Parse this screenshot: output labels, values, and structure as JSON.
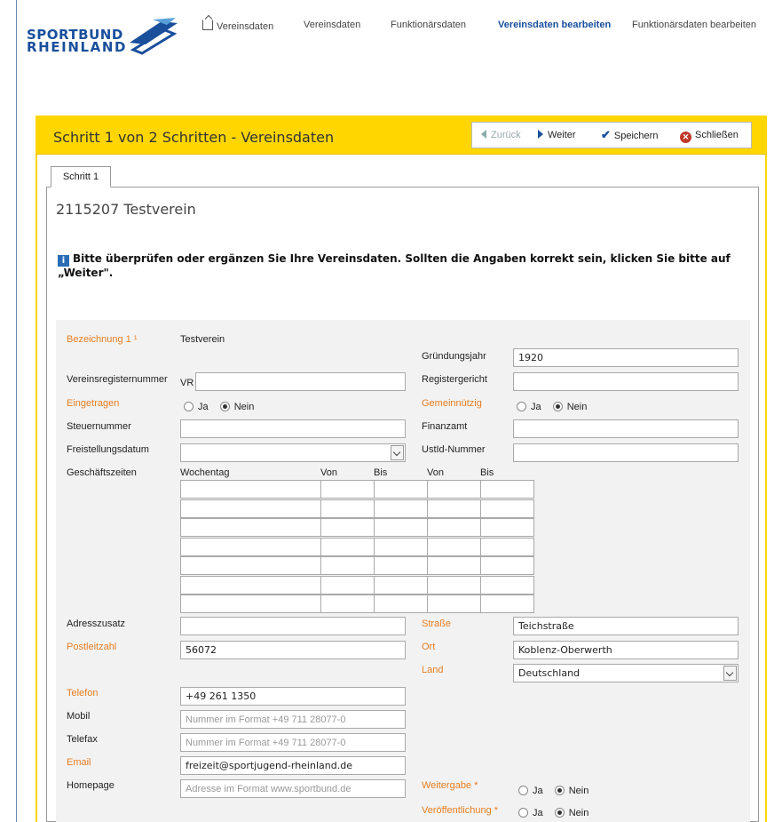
{
  "header": {
    "logo": {
      "line1": "SPORTBUND",
      "line2": "RHEINLAND"
    },
    "nav": [
      {
        "label": "Vereinsdaten",
        "icon": "external-link-icon"
      },
      {
        "label": "Vereinsdaten"
      },
      {
        "label": "Funktionärsdaten"
      },
      {
        "label": "Vereinsdaten bearbeiten",
        "active": true
      },
      {
        "label": "Funktionärsdaten bearbeiten"
      }
    ]
  },
  "wizard": {
    "title": "Schritt 1 von 2 Schritten - Vereinsdaten",
    "toolbar": {
      "back": "Zurück",
      "next": "Weiter",
      "save": "Speichern",
      "close": "Schließen"
    },
    "tab": "Schritt 1",
    "club_title": "2115207 Testverein",
    "info_text": "Bitte überprüfen oder ergänzen Sie Ihre Vereinsdaten. Sollten die Angaben korrekt sein, klicken Sie bitte auf „Weiter\".",
    "info_icon": "i"
  },
  "colors": {
    "accent_yellow": "#ffd600",
    "brand_blue": "#1a4f9c",
    "required_orange": "#e67e22"
  },
  "form": {
    "bezeichnung_label": "Bezeichnung 1 ¹",
    "bezeichnung_value": "Testverein",
    "gruendungsjahr_label": "Gründungsjahr",
    "gruendungsjahr_value": "1920",
    "vereinsregisternummer_label": "Vereinsregisternummer",
    "vr_prefix": "VR",
    "registergericht_label": "Registergericht",
    "eingetragen_label": "Eingetragen",
    "gemeinnuetzig_label": "Gemeinnützig",
    "ja": "Ja",
    "nein": "Nein",
    "steuernummer_label": "Steuernummer",
    "finanzamt_label": "Finanzamt",
    "freistellungsdatum_label": "Freistellungsdatum",
    "ustid_label": "UstId-Nummer",
    "geschaeftszeiten_label": "Geschäftszeiten",
    "hours_headers": {
      "wochentag": "Wochentag",
      "von1": "Von",
      "bis1": "Bis",
      "von2": "Von",
      "bis2": "Bis"
    },
    "adresszusatz_label": "Adresszusatz",
    "strasse_label": "Straße",
    "strasse_value": "Teichstraße",
    "postleitzahl_label": "Postleitzahl",
    "postleitzahl_value": "56072",
    "ort_label": "Ort",
    "ort_value": "Koblenz-Oberwerth",
    "land_label": "Land",
    "land_value": "Deutschland",
    "telefon_label": "Telefon",
    "telefon_value": "+49 261 1350",
    "mobil_label": "Mobil",
    "mobil_placeholder": "Nummer im Format +49 711 28077-0",
    "telefax_label": "Telefax",
    "telefax_placeholder": "Nummer im Format +49 711 28077-0",
    "email_label": "Email",
    "email_value": "freizeit@sportjugend-rheinland.de",
    "homepage_label": "Homepage",
    "homepage_placeholder": "Adresse im Format www.sportbund.de",
    "weitergabe_label": "Weitergabe *",
    "veroeffentlichung_label": "Veröffentlichung *"
  }
}
